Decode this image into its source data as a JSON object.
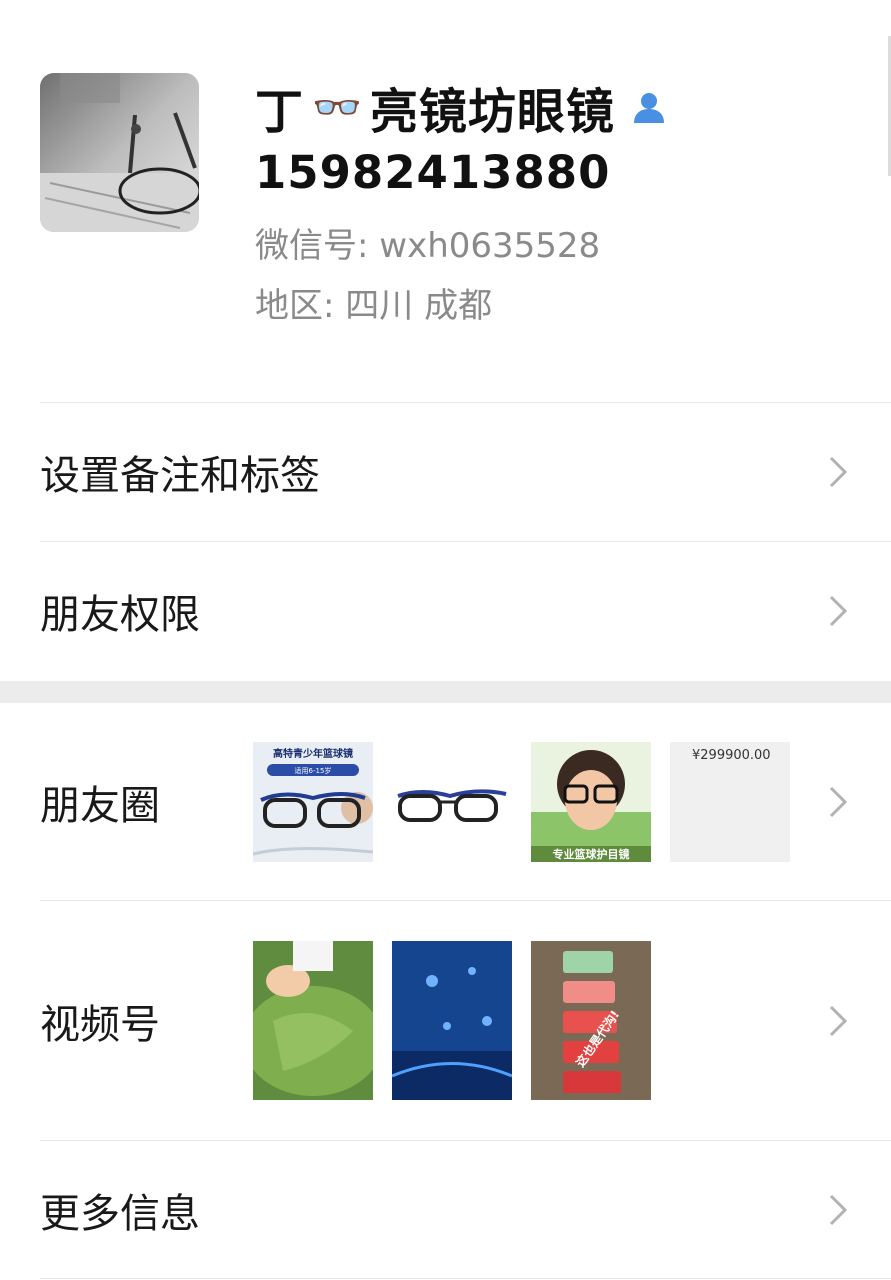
{
  "profile": {
    "name": "丁👓亮镜坊眼镜",
    "name_prefix": "丁",
    "name_emoji": "👓",
    "name_suffix": "亮镜坊眼镜",
    "phone": "15982413880",
    "wechat_id": "微信号: wxh0635528",
    "region": "地区: 四川 成都",
    "avatar_icon": "glasses-photo",
    "contact_icon": "person-icon",
    "accent_color": "#4a90e2"
  },
  "menu": {
    "remarks_label": "设置备注和标签",
    "permissions_label": "朋友权限"
  },
  "moments": {
    "label": "朋友圈",
    "thumbs": [
      {
        "icon": "basketball-glasses-ad",
        "caption": "高特青少年篮球镜",
        "sub": "适用6-15岁"
      },
      {
        "icon": "sport-glasses-photo"
      },
      {
        "icon": "boy-with-glasses-photo",
        "caption": "专业篮球护目镜"
      },
      {
        "icon": "price-post",
        "price": "¥299900.00"
      }
    ]
  },
  "channels": {
    "label": "视频号",
    "thumbs": [
      {
        "icon": "lotus-leaf-video"
      },
      {
        "icon": "aquarium-video"
      },
      {
        "icon": "watermelon-video",
        "caption": "这也是代沟!"
      }
    ]
  },
  "more": {
    "label": "更多信息"
  }
}
